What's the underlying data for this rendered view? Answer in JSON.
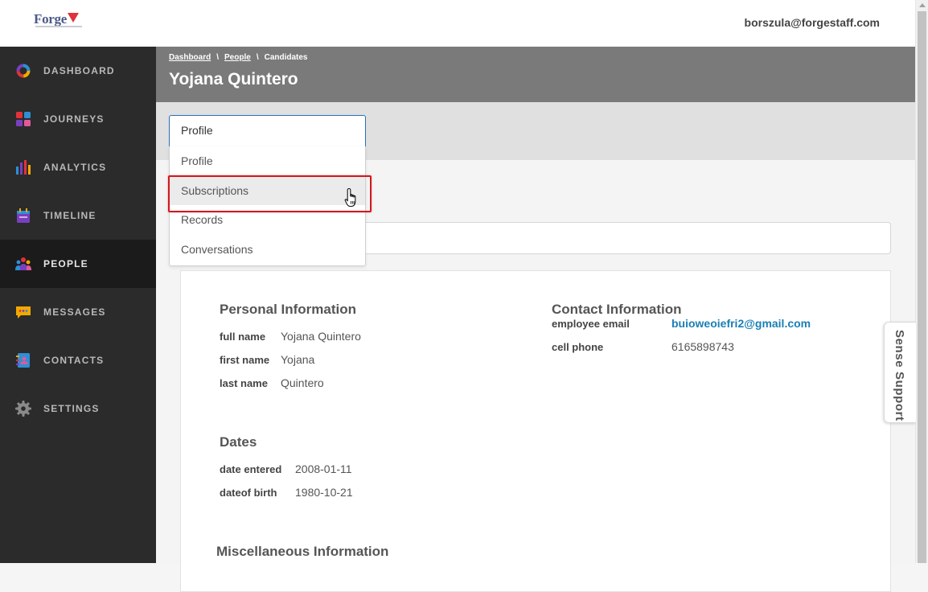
{
  "header": {
    "logo_text": "Forge",
    "user_email": "borszula@forgestaff.com"
  },
  "sidebar": {
    "items": [
      {
        "label": "DASHBOARD"
      },
      {
        "label": "JOURNEYS"
      },
      {
        "label": "ANALYTICS"
      },
      {
        "label": "TIMELINE"
      },
      {
        "label": "PEOPLE"
      },
      {
        "label": "MESSAGES"
      },
      {
        "label": "CONTACTS"
      },
      {
        "label": "SETTINGS"
      }
    ],
    "active": "PEOPLE"
  },
  "breadcrumb": {
    "items": [
      "Dashboard",
      "People",
      "Candidates"
    ],
    "separator": "\\"
  },
  "page_title": "Yojana Quintero",
  "tab_select": {
    "value": "Profile",
    "options": [
      "Profile",
      "Subscriptions",
      "Records",
      "Conversations"
    ],
    "hovered": "Subscriptions"
  },
  "personal": {
    "title": "Personal Information",
    "fields": [
      {
        "label": "full name",
        "value": "Yojana Quintero"
      },
      {
        "label": "first name",
        "value": "Yojana"
      },
      {
        "label": "last name",
        "value": "Quintero"
      }
    ]
  },
  "contact": {
    "title": "Contact Information",
    "fields": [
      {
        "label": "employee email",
        "value": "buioweoiefri2@gmail.com"
      },
      {
        "label": "cell phone",
        "value": "6165898743"
      }
    ]
  },
  "dates": {
    "title": "Dates",
    "fields": [
      {
        "label": "date entered",
        "value": "2008-01-11"
      },
      {
        "label": "dateof birth",
        "value": "1980-10-21"
      }
    ]
  },
  "misc": {
    "title": "Miscellaneous Information"
  },
  "support": {
    "label": "Sense Support"
  },
  "colors": {
    "sidebar_bg": "#2b2b2b",
    "header_bg": "#7a7a7a",
    "link": "#1a7fb5",
    "highlight": "#d0191f"
  }
}
